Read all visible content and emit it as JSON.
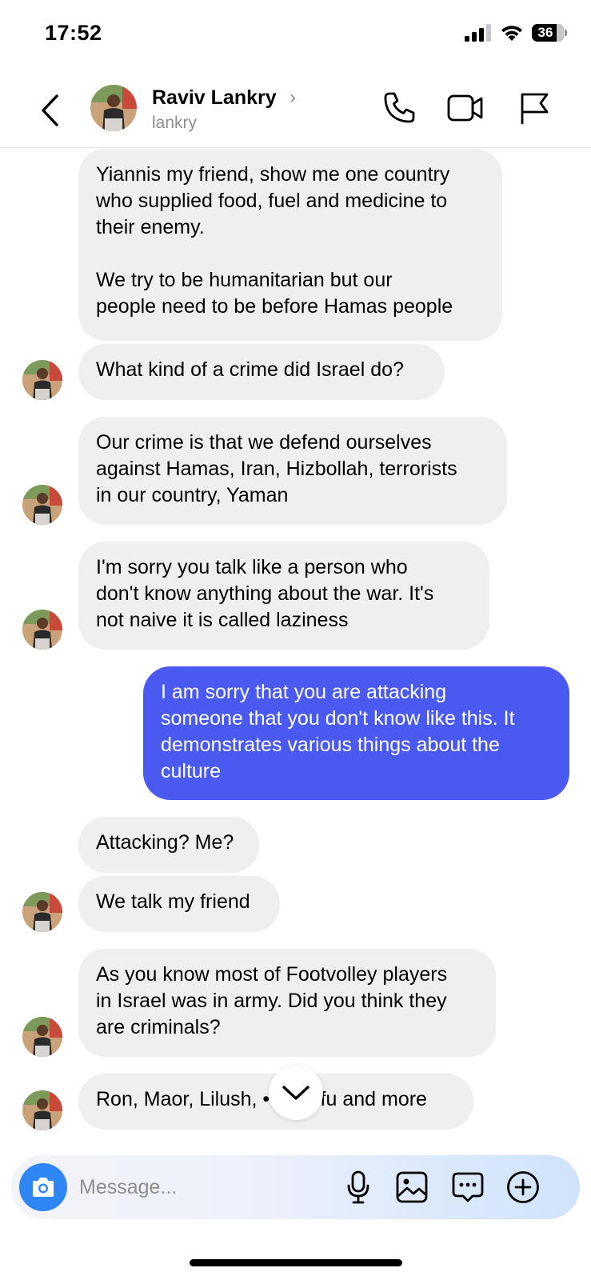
{
  "status_bar": {
    "time": "17:52",
    "battery": "36"
  },
  "header": {
    "name": "Raviv Lankry",
    "username": "lankry",
    "icons": [
      "back-arrow-icon",
      "phone-icon",
      "video-camera-icon",
      "flag-icon"
    ]
  },
  "messages": [
    {
      "from": "them",
      "text": "Yiannis my friend, show me one country\nwho supplied food, fuel and medicine to\ntheir enemy.\n\nWe try to be humanitarian but our\npeople need to be before Hamas people"
    },
    {
      "from": "them",
      "text": "What kind of a crime did Israel do?"
    },
    {
      "from": "them",
      "text": "Our crime is that we defend ourselves\nagainst Hamas, Iran, Hizbollah, terrorists\nin our country, Yaman"
    },
    {
      "from": "them",
      "text": "I'm sorry you talk like a person who\ndon't know anything about the war. It's\nnot naive it is called laziness"
    },
    {
      "from": "me",
      "text": "I am sorry that you are attacking\nsomeone that you don't know like this. It\ndemonstrates various things about the\nculture"
    },
    {
      "from": "them",
      "text": "Attacking? Me?"
    },
    {
      "from": "them",
      "text": "We talk my friend"
    },
    {
      "from": "them",
      "text": "As you know most of Footvolley players\nin Israel was in army. Did you think they\nare criminals?"
    },
    {
      "from": "them",
      "text": "Ron, Maor, Lilush, •••, Hofu and more"
    }
  ],
  "composer": {
    "placeholder": "Message...",
    "icons": [
      "camera-icon",
      "microphone-icon",
      "gallery-icon",
      "sticker-chat-icon",
      "plus-icon"
    ]
  },
  "colors": {
    "sent_bubble": "#4a5af0",
    "received_bubble": "#efefef",
    "camera_button": "#2f86f5"
  }
}
